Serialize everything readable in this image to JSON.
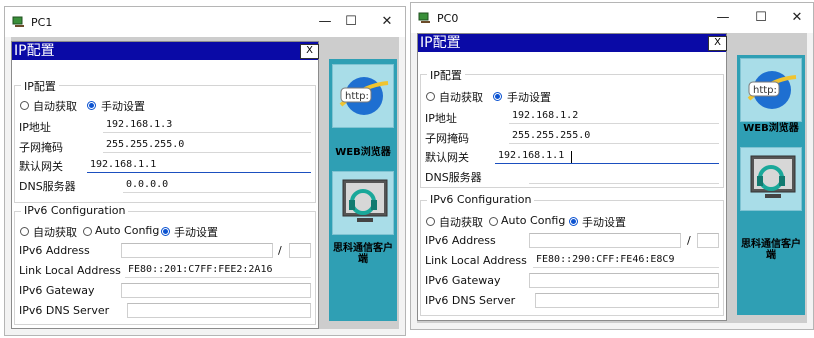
{
  "windows": [
    {
      "title": "PC1",
      "controls": {
        "minimize": "—",
        "maximize": "☐",
        "close": "✕"
      },
      "desktop": {
        "web_browser_label": "WEB浏览器",
        "web_icon_text": "http:",
        "client_label": "思科通信客户端"
      },
      "dialog": {
        "title": "IP配置",
        "close": "X",
        "ipv4": {
          "legend": "IP配置",
          "mode_auto": "自动获取",
          "mode_manual": "手动设置",
          "ip_label": "IP地址",
          "ip_value": "192.168.1.3",
          "mask_label": "子网掩码",
          "mask_value": "255.255.255.0",
          "gateway_label": "默认网关",
          "gateway_value": "192.168.1.1",
          "dns_label": "DNS服务器",
          "dns_value": "0.0.0.0"
        },
        "ipv6": {
          "legend": "IPv6 Configuration",
          "mode_auto": "自动获取",
          "mode_autoconfig": "Auto Config",
          "mode_manual": "手动设置",
          "address_label": "IPv6 Address",
          "address_value": "",
          "prefix_sep": "/",
          "prefix_value": "",
          "link_local_label": "Link Local Address",
          "link_local_value": "FE80::201:C7FF:FEE2:2A16",
          "gateway_label": "IPv6 Gateway",
          "gateway_value": "",
          "dns_label": "IPv6 DNS Server",
          "dns_value": ""
        }
      }
    },
    {
      "title": "PC0",
      "controls": {
        "minimize": "—",
        "maximize": "☐",
        "close": "✕"
      },
      "desktop": {
        "web_browser_label": "WEB浏览器",
        "web_icon_text": "http:",
        "client_label": "思科通信客户端"
      },
      "dialog": {
        "title": "IP配置",
        "close": "X",
        "ipv4": {
          "legend": "IP配置",
          "mode_auto": "自动获取",
          "mode_manual": "手动设置",
          "ip_label": "IP地址",
          "ip_value": "192.168.1.2",
          "mask_label": "子网掩码",
          "mask_value": "255.255.255.0",
          "gateway_label": "默认网关",
          "gateway_value": "192.168.1.1",
          "dns_label": "DNS服务器",
          "dns_value": ""
        },
        "ipv6": {
          "legend": "IPv6 Configuration",
          "mode_auto": "自动获取",
          "mode_autoconfig": "Auto Config",
          "mode_manual": "手动设置",
          "address_label": "IPv6 Address",
          "address_value": "",
          "prefix_sep": "/",
          "prefix_value": "",
          "link_local_label": "Link Local Address",
          "link_local_value": "FE80::290:CFF:FE46:E8C9",
          "gateway_label": "IPv6 Gateway",
          "gateway_value": "",
          "dns_label": "IPv6 DNS Server",
          "dns_value": ""
        }
      }
    }
  ],
  "colors": {
    "dialog_title": "#0a0aa6",
    "desktop": "#2f9fb4",
    "radio_selected": "#0c53d1"
  }
}
